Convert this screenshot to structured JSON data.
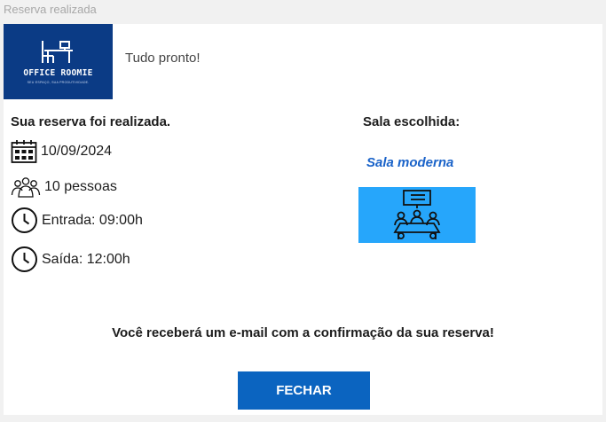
{
  "window": {
    "title": "Reserva realizada"
  },
  "brand": {
    "logo_name": "OFFICE ROOMIE",
    "logo_tagline": "Seu espaço, sua produtividade.",
    "logo_color": "#0b3b85"
  },
  "header": {
    "greeting": "Tudo pronto!"
  },
  "reservation": {
    "heading": "Sua reserva foi realizada.",
    "date": "10/09/2024",
    "people": "10 pessoas",
    "entry": "Entrada: 09:00h",
    "exit": "Saída: 12:00h"
  },
  "room": {
    "heading": "Sala escolhida:",
    "name": "Sala moderna",
    "image_bg": "#26a6fb",
    "image_icon": "meeting-room-icon"
  },
  "icons": {
    "date": "calendar-icon",
    "people": "people-group-icon",
    "entry": "clock-icon",
    "exit": "clock-icon"
  },
  "footer": {
    "message": "Você receberá um e-mail com a confirmação da sua reserva!",
    "close_label": "FECHAR",
    "button_color": "#0b64c0"
  },
  "colors": {
    "accent_link": "#1a63c9",
    "page_bg": "#f1f1f1"
  }
}
